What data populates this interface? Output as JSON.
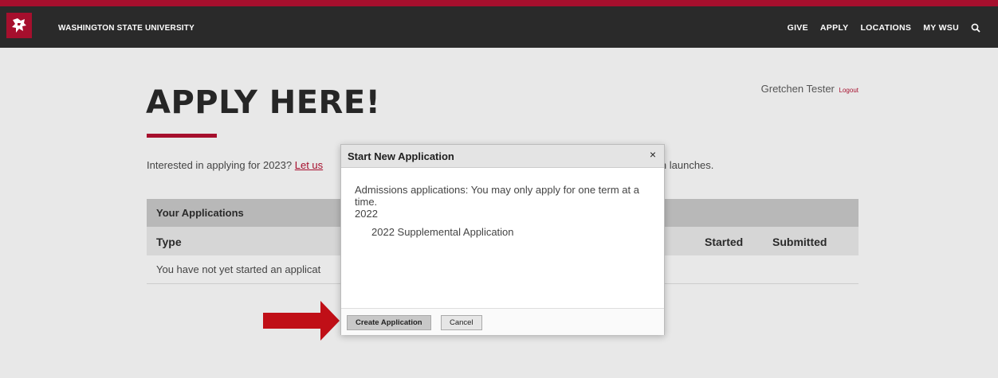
{
  "header": {
    "university_name": "WASHINGTON STATE UNIVERSITY",
    "nav": [
      "GIVE",
      "APPLY",
      "LOCATIONS",
      "MY WSU"
    ]
  },
  "user": {
    "name": "Gretchen Tester",
    "logout_label": "Logout"
  },
  "page": {
    "title": "APPLY HERE!",
    "interest_prefix": "Interested in applying for 2023? ",
    "interest_link": "Let us",
    "interest_suffix": "tion launches."
  },
  "applications": {
    "heading": "Your Applications",
    "col_type": "Type",
    "col_started": "Started",
    "col_submitted": "Submitted",
    "empty_text": "You have not yet started an applicat"
  },
  "modal": {
    "title": "Start New Application",
    "close_glyph": "×",
    "message": "Admissions applications: You may only apply for one term at a time.",
    "year": "2022",
    "option": "2022 Supplemental Application",
    "create_label": "Create Application",
    "cancel_label": "Cancel"
  },
  "colors": {
    "brand": "#a60f2d",
    "topbar": "#2a2a2a",
    "background": "#e8e8e8"
  }
}
